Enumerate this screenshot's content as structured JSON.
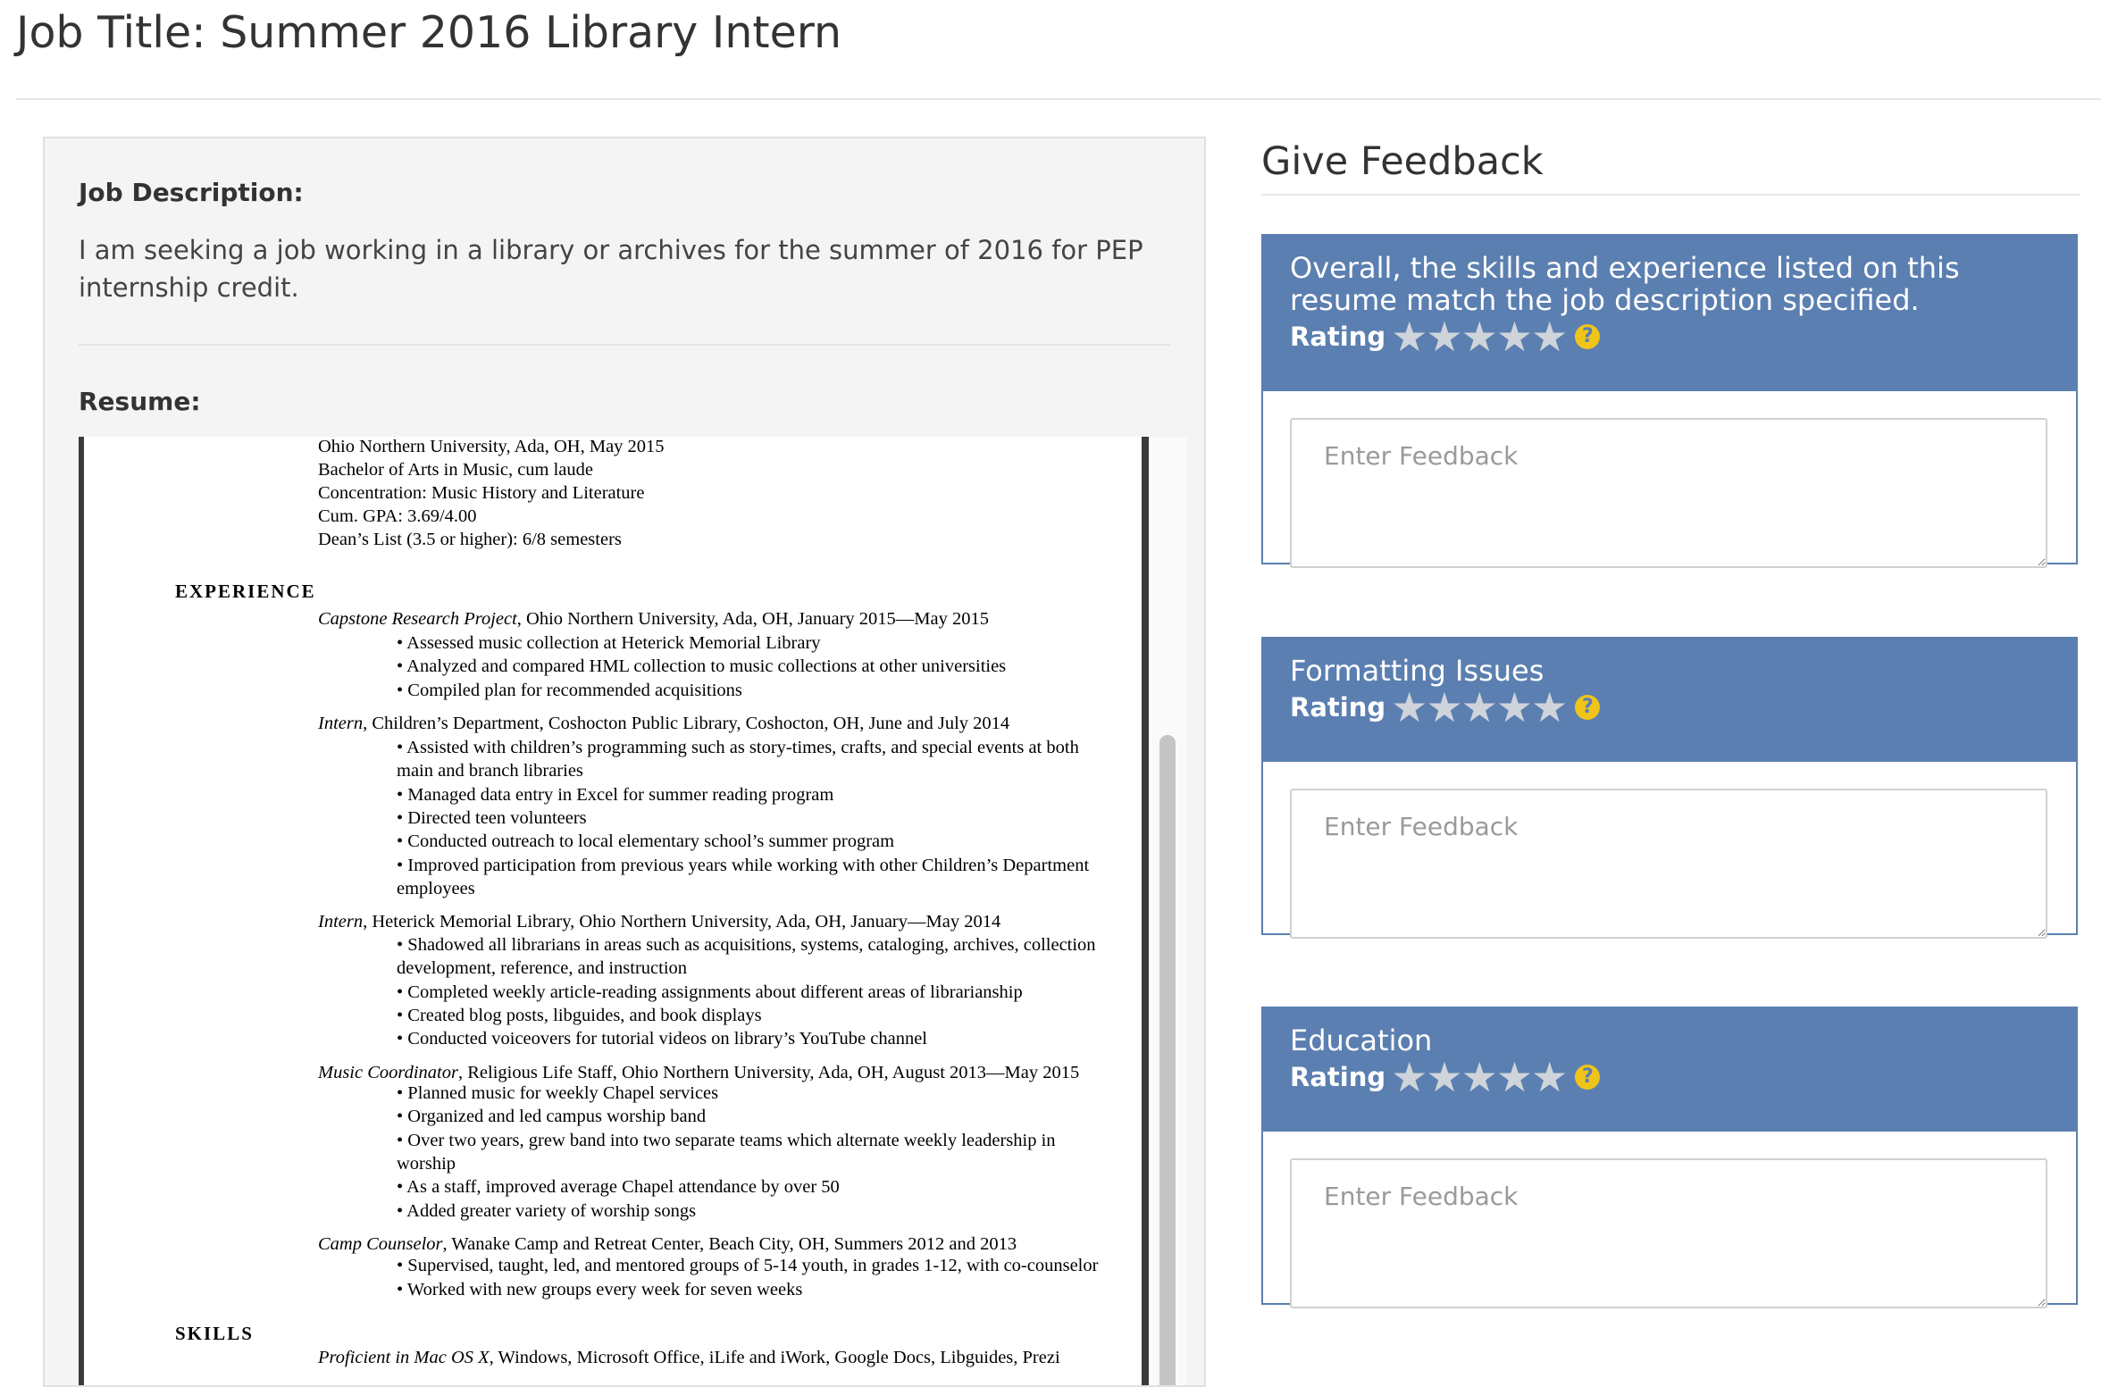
{
  "page": {
    "title": "Job Title: Summer 2016 Library Intern"
  },
  "job": {
    "description_label": "Job Description:",
    "description_text": "I am seeking a job working in a library or archives for the summer of 2016 for PEP internship credit.",
    "resume_label": "Resume:"
  },
  "resume": {
    "lines": [
      {
        "text": "Ohio Northern University, Ada, OH, May 2015",
        "style": "normal"
      },
      {
        "text": "Bachelor of Arts in Music, cum laude",
        "style": "normal"
      },
      {
        "text": "Concentration: Music History and Literature",
        "style": "normal"
      },
      {
        "text": "Cum. GPA: 3.69/4.00",
        "style": "normal"
      },
      {
        "text": "Dean’s List (3.5 or higher): 6/8 semesters",
        "style": "normal"
      },
      {
        "text": "EXPERIENCE",
        "style": "heading"
      },
      {
        "text": "Capstone Research Project, Ohio Northern University, Ada, OH, January 2015—May 2015",
        "style": "job"
      },
      {
        "text": "•  Assessed music collection at Heterick Memorial Library",
        "style": "bullet"
      },
      {
        "text": "•  Analyzed and compared HML collection to music collections at other universities",
        "style": "bullet"
      },
      {
        "text": "•  Compiled plan for recommended acquisitions",
        "style": "bullet"
      },
      {
        "text": "Intern, Children’s Department, Coshocton Public Library, Coshocton, OH, June and July 2014",
        "style": "job"
      },
      {
        "text": "•  Assisted with children’s programming such as story-times, crafts, and special events at both",
        "style": "bullet"
      },
      {
        "text": "main and branch libraries",
        "style": "cont"
      },
      {
        "text": "•  Managed data entry in Excel for summer reading program",
        "style": "bullet"
      },
      {
        "text": "•  Directed teen volunteers",
        "style": "bullet"
      },
      {
        "text": "•  Conducted outreach to local elementary school’s summer program",
        "style": "bullet"
      },
      {
        "text": "•  Improved participation from previous years while working with other Children’s Department",
        "style": "bullet"
      },
      {
        "text": "employees",
        "style": "cont"
      },
      {
        "text": "Intern, Heterick Memorial Library, Ohio Northern University, Ada, OH, January—May 2014",
        "style": "job"
      },
      {
        "text": "•  Shadowed all librarians in areas such as acquisitions, systems, cataloging, archives, collection",
        "style": "bullet"
      },
      {
        "text": "development, reference, and instruction",
        "style": "cont"
      },
      {
        "text": "•  Completed weekly article-reading assignments about different areas of librarianship",
        "style": "bullet"
      },
      {
        "text": "•  Created blog posts, libguides, and book displays",
        "style": "bullet"
      },
      {
        "text": "•  Conducted voiceovers for tutorial videos on library’s YouTube channel",
        "style": "bullet"
      },
      {
        "text": "Music Coordinator, Religious Life Staff, Ohio Northern University, Ada, OH, August 2013—May 2015",
        "style": "job"
      },
      {
        "text": "•  Planned music for weekly Chapel services",
        "style": "bullet"
      },
      {
        "text": "•  Organized and led campus worship band",
        "style": "bullet"
      },
      {
        "text": "•  Over two years, grew band into two separate teams which alternate weekly leadership in",
        "style": "bullet"
      },
      {
        "text": "worship",
        "style": "cont"
      },
      {
        "text": "•  As a staff, improved average Chapel attendance by over 50",
        "style": "bullet"
      },
      {
        "text": "•  Added greater variety of worship songs",
        "style": "bullet"
      },
      {
        "text": "Camp Counselor, Wanake Camp and Retreat Center, Beach City, OH, Summers 2012 and 2013",
        "style": "job"
      },
      {
        "text": "•  Supervised, taught, led, and mentored groups of 5-14 youth, in grades 1-12, with co-counselor",
        "style": "bullet"
      },
      {
        "text": "•  Worked with new groups every week for seven weeks",
        "style": "bullet"
      },
      {
        "text": "SKILLS",
        "style": "heading"
      },
      {
        "text": "Proficient in Mac OS X, Windows, Microsoft Office, iLife and iWork, Google Docs, Libguides, Prezi",
        "style": "job"
      }
    ]
  },
  "feedback": {
    "heading": "Give Feedback",
    "rating_label": "Rating",
    "placeholder": "Enter Feedback",
    "star_glyph": "★",
    "help_glyph": "?",
    "star_color": "#cfd4db",
    "accent_color": "#5b7fb0",
    "help_color": "#f0c419",
    "cards": [
      {
        "question": "Overall, the skills and experience listed on this resume match the job description specified.",
        "rating": 0
      },
      {
        "question": "Formatting Issues",
        "rating": 0
      },
      {
        "question": "Education",
        "rating": 0
      }
    ]
  }
}
